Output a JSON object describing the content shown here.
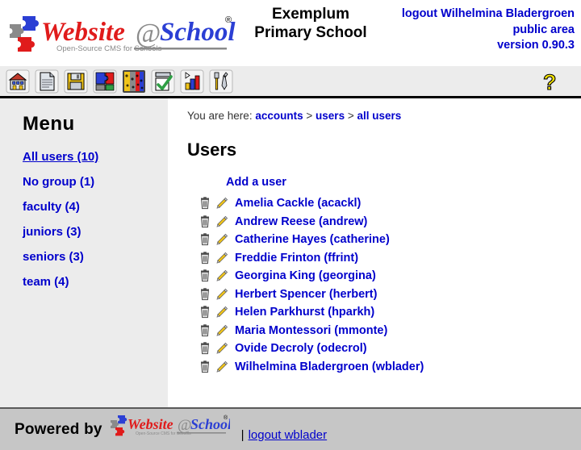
{
  "header": {
    "logo_text": "Website@School",
    "logo_tagline": "Open-Source CMS for Schools",
    "logo_registered": "®",
    "school_name_line1": "Exemplum",
    "school_name_line2": "Primary School",
    "logout_label": "logout Wilhelmina Bladergroen",
    "area_label": "public area",
    "version_label": "version 0.90.3",
    "link_color": "#0000cc"
  },
  "toolbar": {
    "icons": [
      {
        "name": "school-icon",
        "title": "school"
      },
      {
        "name": "page-icon",
        "title": "page"
      },
      {
        "name": "save-icon",
        "title": "save"
      },
      {
        "name": "modules-icon",
        "title": "modules"
      },
      {
        "name": "pages-icon",
        "title": "pages"
      },
      {
        "name": "tasks-icon",
        "title": "tasks"
      },
      {
        "name": "statistics-icon",
        "title": "statistics"
      },
      {
        "name": "tools-icon",
        "title": "tools"
      }
    ],
    "help_icon": "help-icon",
    "help_title": "help"
  },
  "sidebar": {
    "title": "Menu",
    "items": [
      {
        "label": "All users (10)",
        "active": true
      },
      {
        "label": "No group (1)",
        "active": false
      },
      {
        "label": "faculty (4)",
        "active": false
      },
      {
        "label": "juniors (3)",
        "active": false
      },
      {
        "label": "seniors (3)",
        "active": false
      },
      {
        "label": "team (4)",
        "active": false
      }
    ]
  },
  "breadcrumb": {
    "prefix": "You are here:",
    "crumbs": [
      "accounts",
      "users",
      "all users"
    ],
    "separator": ">"
  },
  "main": {
    "title": "Users",
    "add_user_label": "Add a user",
    "row_icons": {
      "delete": "trash-icon",
      "edit": "pencil-icon"
    },
    "users": [
      {
        "label": "Amelia Cackle (acackl)"
      },
      {
        "label": "Andrew Reese (andrew)"
      },
      {
        "label": "Catherine Hayes (catherine)"
      },
      {
        "label": "Freddie Frinton (ffrint)"
      },
      {
        "label": "Georgina King (georgina)"
      },
      {
        "label": "Herbert Spencer (herbert)"
      },
      {
        "label": "Helen Parkhurst (hparkh)"
      },
      {
        "label": "Maria Montessori (mmonte)"
      },
      {
        "label": "Ovide Decroly (odecrol)"
      },
      {
        "label": "Wilhelmina Bladergroen (wblader)"
      }
    ]
  },
  "footer": {
    "powered_by": "Powered by",
    "logo_text": "Website@School",
    "logo_tagline": "Open-Source CMS for Schools",
    "separator": "|",
    "logout_label": "logout wblader"
  }
}
